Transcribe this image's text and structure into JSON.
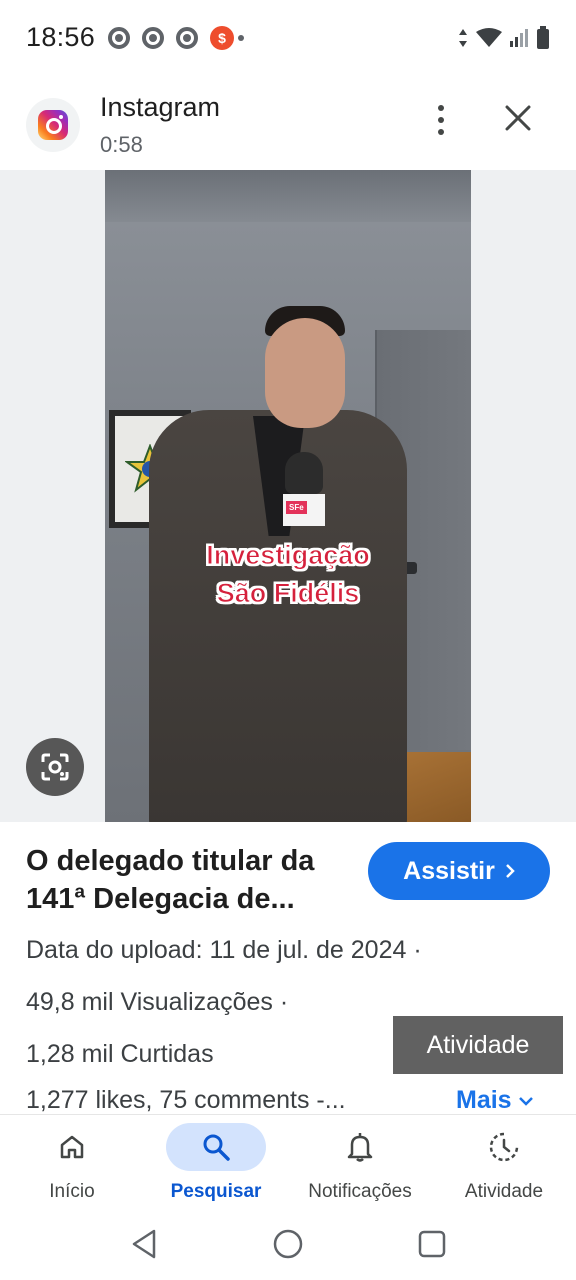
{
  "status_bar": {
    "time": "18:56",
    "notification_icons": [
      "chrome-icon",
      "chrome-icon",
      "chrome-icon",
      "shopee-icon"
    ],
    "system_icons": [
      "data-arrows-icon",
      "wifi-icon",
      "signal-icon",
      "battery-icon"
    ]
  },
  "header": {
    "app_name": "Instagram",
    "duration": "0:58"
  },
  "media": {
    "caption_line1": "Investigação",
    "caption_line2": "São Fidélis"
  },
  "details": {
    "title_line1": "O delegado titular da",
    "title_line2": "141ª Delegacia de...",
    "watch_label": "Assistir",
    "upload": "Data do upload: 11 de jul. de 2024 ·",
    "views": "49,8 mil Visualizações ·",
    "likes": "1,28 mil Curtidas",
    "description": "1,277 likes, 75 comments -...",
    "activity_tooltip": "Atividade",
    "more_label": "Mais"
  },
  "bottom_nav": {
    "items": [
      {
        "label": "Início",
        "icon": "home-icon"
      },
      {
        "label": "Pesquisar",
        "icon": "search-icon"
      },
      {
        "label": "Notificações",
        "icon": "bell-icon"
      },
      {
        "label": "Atividade",
        "icon": "activity-icon"
      }
    ],
    "active_index": 1
  },
  "colors": {
    "accent": "#1a73e8",
    "active_pill": "#d3e3fd",
    "caption_red": "#d5213c"
  }
}
